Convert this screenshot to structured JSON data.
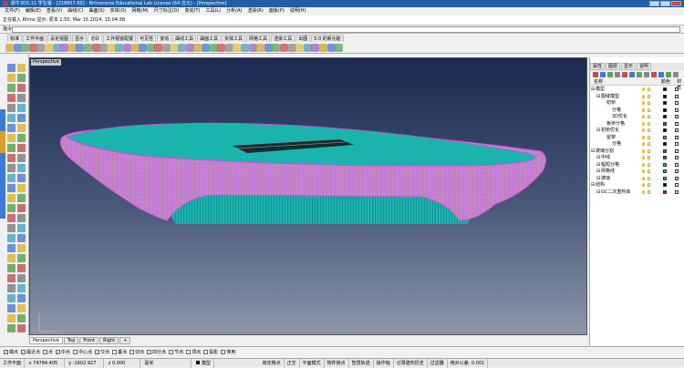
{
  "window": {
    "title": "犀牛3D5.11 学生版 - [218857.60] - Rhinoceros Educational Lab License (64 位元) - [Perspective]"
  },
  "menu": [
    "文件(F)",
    "编辑(E)",
    "查看(V)",
    "曲线(C)",
    "曲面(S)",
    "实体(O)",
    "网格(M)",
    "尺寸标注(D)",
    "变动(T)",
    "工具(L)",
    "分析(A)",
    "渲染(R)",
    "面板(P)",
    "说明(H)"
  ],
  "command_history": "正在载入 Rhino 显示: 原本 1:50, Mar 15 2014, 15:04:38",
  "command_prompt": "指令:",
  "toolbar_tabs": [
    {
      "label": "标准",
      "active": false
    },
    {
      "label": "工作平面",
      "active": false
    },
    {
      "label": "设定视图",
      "active": false
    },
    {
      "label": "显示",
      "active": false
    },
    {
      "label": "选取",
      "active": true
    },
    {
      "label": "工作视窗配置",
      "active": false
    },
    {
      "label": "可见性",
      "active": false
    },
    {
      "label": "变动",
      "active": false
    },
    {
      "label": "曲线工具",
      "active": false
    },
    {
      "label": "曲面工具",
      "active": false
    },
    {
      "label": "实体工具",
      "active": false
    },
    {
      "label": "网格工具",
      "active": false
    },
    {
      "label": "渲染工具",
      "active": false
    },
    {
      "label": "出图",
      "active": false
    },
    {
      "label": "5.0 的新功能",
      "active": false
    }
  ],
  "viewport": {
    "label": "Perspective"
  },
  "viewport_tabs": [
    {
      "label": "Perspective",
      "active": true
    },
    {
      "label": "Top",
      "active": false
    },
    {
      "label": "Front",
      "active": false
    },
    {
      "label": "Right",
      "active": false
    },
    {
      "label": "+",
      "active": false
    }
  ],
  "osnaps": [
    {
      "label": "端点",
      "checked": true
    },
    {
      "label": "最近点",
      "checked": true
    },
    {
      "label": "点",
      "checked": false
    },
    {
      "label": "中点",
      "checked": true
    },
    {
      "label": "中心点",
      "checked": false
    },
    {
      "label": "交点",
      "checked": true
    },
    {
      "label": "垂点",
      "checked": false
    },
    {
      "label": "切点",
      "checked": false
    },
    {
      "label": "四分点",
      "checked": false
    },
    {
      "label": "节点",
      "checked": false
    },
    {
      "label": "顶点",
      "checked": false
    },
    {
      "label": "投影",
      "checked": false
    },
    {
      "label": "停用",
      "checked": false
    }
  ],
  "statusbar": {
    "plane": "工作平面",
    "x": "x 74784.405",
    "y": "y -1602.927",
    "z": "z 0.000",
    "units": "毫米",
    "layer": "模型",
    "items": [
      "锁定格点",
      "正交",
      "平面模式",
      "物件锁点",
      "智慧轨迹",
      "操作轴",
      "记录建构历史",
      "过滤器",
      "绝对公差: 0.001"
    ]
  },
  "right_panel": {
    "tabs": [
      "属性",
      "图层",
      "显示",
      "说明"
    ],
    "headers": {
      "name": "名称",
      "material_color": "颜色",
      "material": "材质"
    },
    "layers": [
      {
        "name": "模型",
        "indent": 0,
        "color": "#000000",
        "selected": false
      },
      {
        "name": "图缝模型",
        "indent": 1,
        "color": "#000000",
        "selected": false
      },
      {
        "name": "初桥",
        "indent": 2,
        "color": "#000000",
        "selected": false
      },
      {
        "name": "分格",
        "indent": 3,
        "color": "#000000",
        "selected": false
      },
      {
        "name": "3D优化",
        "indent": 3,
        "color": "#000000",
        "selected": false
      },
      {
        "name": "板桥分格",
        "indent": 2,
        "color": "#8e2bd8",
        "selected": false
      },
      {
        "name": "初桥优化",
        "indent": 1,
        "color": "#000000",
        "selected": false
      },
      {
        "name": "屋架",
        "indent": 2,
        "color": "#1fb8b8",
        "selected": false
      },
      {
        "name": "分格",
        "indent": 3,
        "color": "#000000",
        "selected": false
      },
      {
        "name": "玻璃分割",
        "indent": 0,
        "color": "#e02020",
        "selected": false
      },
      {
        "name": "中线",
        "indent": 1,
        "color": "#3060e0",
        "selected": false
      },
      {
        "name": "幅短分格",
        "indent": 1,
        "color": "#20c020",
        "selected": false
      },
      {
        "name": "网格线",
        "indent": 1,
        "color": "#20c020",
        "selected": false
      },
      {
        "name": "玻璃",
        "indent": 1,
        "color": "#1fb8b8",
        "selected": false
      },
      {
        "name": "结构",
        "indent": 0,
        "color": "#000000",
        "selected": false
      },
      {
        "name": "GC二次重构体",
        "indent": 1,
        "color": "#e02020",
        "selected": false
      }
    ]
  },
  "colors": {
    "viewport_top": "#19294f",
    "viewport_bottom": "#8c97aa",
    "surface_teal": "#1bb4ad",
    "wire_magenta": "#e040e0",
    "titlebar": "#1f5fa6"
  }
}
